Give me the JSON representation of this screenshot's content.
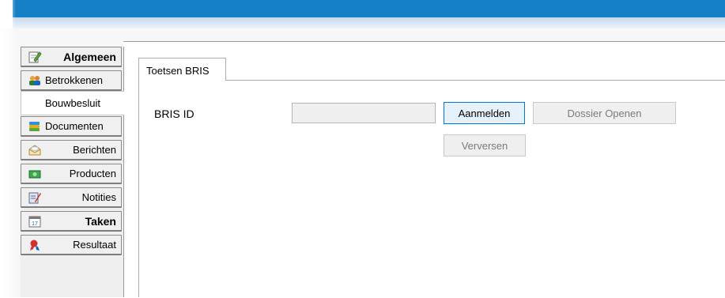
{
  "sidebar": {
    "items": [
      {
        "label": "Algemeen",
        "icon": "edit-icon",
        "bold": true,
        "active": false
      },
      {
        "label": "Betrokkenen",
        "icon": "people-icon",
        "bold": false,
        "active": false
      },
      {
        "label": "Bouwbesluit",
        "icon": "",
        "bold": false,
        "active": true
      },
      {
        "label": "Documenten",
        "icon": "documents-icon",
        "bold": false,
        "active": false
      },
      {
        "label": "Berichten",
        "icon": "envelope-icon",
        "bold": false,
        "active": false
      },
      {
        "label": "Producten",
        "icon": "money-icon",
        "bold": false,
        "active": false
      },
      {
        "label": "Notities",
        "icon": "notes-icon",
        "bold": false,
        "active": false
      },
      {
        "label": "Taken",
        "icon": "calendar-icon",
        "bold": true,
        "active": false
      },
      {
        "label": "Resultaat",
        "icon": "award-icon",
        "bold": false,
        "active": false
      }
    ]
  },
  "tab": {
    "label": "Toetsen BRIS"
  },
  "form": {
    "bris_label": "BRIS ID",
    "bris_value": "",
    "aanmelden_label": "Aanmelden",
    "dossier_label": "Dossier Openen",
    "verversen_label": "Verversen"
  },
  "colors": {
    "titlebar": "#1680c7",
    "focus_border": "#0078d7"
  }
}
